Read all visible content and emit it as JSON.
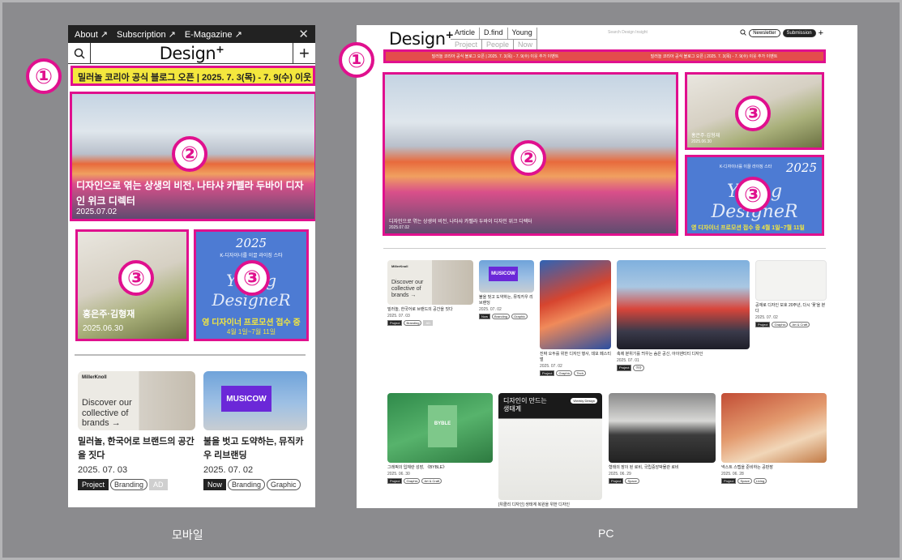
{
  "captions": {
    "mobile": "모바일",
    "pc": "PC"
  },
  "colors": {
    "highlight": "#e0108e",
    "ticker_mobile": "#f4e73d",
    "ticker_pc": "#e44c4c",
    "youth_blue": "#4d7bd3",
    "background": "#8b8b8e"
  },
  "badges": {
    "one": "①",
    "two": "②",
    "three": "③"
  },
  "mobile": {
    "topbar": {
      "about": "About ↗",
      "subscription": "Subscription ↗",
      "emagazine": "E-Magazine ↗",
      "close": "✕"
    },
    "header": {
      "logo": "Design",
      "logo_plus": "+",
      "search_icon": "search-icon",
      "plus": "+"
    },
    "ticker": "밀러놀 코리아 공식 블로그 오픈 | 2025. 7. 3(목) - 7. 9(수) 이웃 추",
    "hero": {
      "title": "디자인으로 엮는 상생의 비전, 나타샤 카펠라 두바이 디자인 위크 디렉터",
      "date": "2025.07.02"
    },
    "card1": {
      "title": "홍은주·김형재",
      "date": "2025.06.30"
    },
    "card2": {
      "year": "2025",
      "small": "K-디자이너를 이끌 라이징 스타",
      "script": "Young DesigneR",
      "title": "영 디자이너 프로모션 접수 중",
      "dates": "4월 1일~7월 11일"
    },
    "news": [
      {
        "brand": "MillerKnoll",
        "thumb_text": "Discover our collective of brands →",
        "title": "밀러놀, 한국어로 브랜드의 공간을 짓다",
        "date": "2025. 07. 03",
        "tags": [
          "Project",
          "Branding",
          "AD"
        ]
      },
      {
        "sign": "MUSICOW",
        "title": "불을 벗고 도약하는, 뮤직카우 리브랜딩",
        "date": "2025. 07. 02",
        "tags": [
          "Now",
          "Branding",
          "Graphic"
        ]
      }
    ]
  },
  "pc": {
    "logo": "Design",
    "logo_plus": "+",
    "nav_row1": [
      "Article",
      "D.find",
      "Young"
    ],
    "nav_row2": [
      "Project",
      "People",
      "Now"
    ],
    "search_placeholder": "Search Design Insight",
    "newsletter": "Newsletter",
    "submission": "Submission",
    "plus": "+",
    "ticker_items": [
      "밀러놀 코리아 공식 블로그 오픈 | 2025. 7. 3(목) - 7. 9(수) 이웃 추가 이벤트",
      "밀러놀 코리아 공식 블로그 오픈 | 2025. 7. 3(목) - 7. 9(수) 이웃 추가 이벤트"
    ],
    "hero": {
      "title": "디자인으로 엮는 상생의 비전, 나타샤 카펠라 두바이 디자인 위크 디렉터",
      "date": "2025.07.02"
    },
    "card1": {
      "title": "홍은주·김형재",
      "date": "2025.06.30"
    },
    "card2": {
      "small": "K-디자이너를 이끌 라이징 스타",
      "year": "2025",
      "script": "Young DesigneR",
      "title": "영 디자이너 프로모션 접수 중 4월 1일~7월 11일"
    },
    "grid1": [
      {
        "brand": "MillerKnoll",
        "thumb_text": "Discover our collective of brands →",
        "title": "밀러놀, 한국어로 브랜드의 공간을 짓다",
        "date": "2025. 07. 03",
        "tags": [
          "Project",
          "Branding",
          "AD"
        ]
      },
      {
        "sign": "MUSICOW",
        "title": "불을 벗고 도약하는, 뮤직카우 리브랜딩",
        "date": "2025. 07. 02",
        "tags": [
          "Now",
          "Branding",
          "Graphic"
        ]
      },
      {
        "title": "진짜 오두를 위한 디자인 행사, 데모 페스티벌",
        "date": "2025. 07. 02",
        "tags": [
          "Project",
          "Graphic",
          "Tech"
        ]
      },
      {
        "title": "축제 분위기를 띄우는 숨은 공신, 아이덴티티 디자인",
        "date": "2025. 07. 01",
        "tags": [
          "Project",
          "이슈"
        ]
      },
      {
        "title": "공재로 디자인 보호 20주년, 다시 '꽃'을 본다",
        "date": "2025. 07. 02",
        "tags": [
          "Project",
          "Graphic",
          "Art & Craft"
        ]
      }
    ],
    "grid2": [
      {
        "title": "그래픽의 입체란 성장, 《BYBLE》",
        "date": "2025. 06. 30",
        "tags": [
          "Project",
          "Graphic",
          "Art & Craft"
        ],
        "label": "BYBLE"
      },
      {
        "title": "[위클리 디자인] 생태계 복원을 위한 디자인",
        "header": "디자인이 만드는 생태계",
        "badge": "Weekly Design"
      },
      {
        "title": "형태의 장이 된 로비, 국립중앙박물관 로비",
        "date": "2025. 06. 29",
        "tags": [
          "Project",
          "Space"
        ]
      },
      {
        "title": "넥스트 스텝을 준비하는 공판장",
        "date": "2025. 06. 28",
        "tags": [
          "Project",
          "Space",
          "Living"
        ]
      }
    ]
  }
}
